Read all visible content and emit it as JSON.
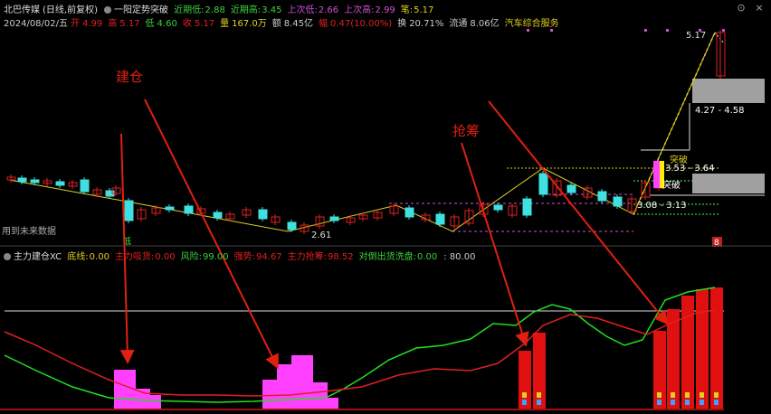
{
  "header": {
    "stock_name": "北巴传媒",
    "period": "(日线,前复权)",
    "indicator_name": "一阳定势突破",
    "items": [
      {
        "label": "近期低:",
        "value": "2.88",
        "color": "#3dd13d"
      },
      {
        "label": "近期高:",
        "value": "3.45",
        "color": "#3dd13d"
      },
      {
        "label": "上次低:",
        "value": "2.66",
        "color": "#d050d0"
      },
      {
        "label": "上次高:",
        "value": "2.99",
        "color": "#d050d0"
      },
      {
        "label": "笔:",
        "value": "5.17",
        "color": "#e0d020"
      }
    ]
  },
  "quote": {
    "date": "2024/08/02/五",
    "open_label": "开",
    "open": "4.99",
    "high_label": "高",
    "high": "5.17",
    "low_label": "低",
    "low": "4.60",
    "close_label": "收",
    "close": "5.17",
    "volume_label": "量",
    "volume": "167.0万",
    "amount_label": "额",
    "amount": "8.45亿",
    "change_label": "幅",
    "change": "0.47(10.00%)",
    "turnover_label": "换",
    "turnover": "20.71%",
    "float_label": "流通",
    "float": "8.06亿",
    "sector": "汽车综合服务"
  },
  "annotations": {
    "build": "建仓",
    "grab": "抢筹",
    "future_data": "用到未来数据",
    "low_price": "2.61",
    "high_price": "5.17",
    "breakout": "突破",
    "breakout2": "突破",
    "box_upper": "4.27 - 4.58",
    "box_mid": "3.53 - 3.64",
    "box_lower": "3.08 - 3.13",
    "dd_label": "低",
    "s_badge": "8"
  },
  "indicator": {
    "name": "主力建仓XC",
    "items": [
      {
        "label": "底线:",
        "value": "0.00",
        "color": "#e0d020"
      },
      {
        "label": "主力吸货:",
        "value": "0.00",
        "color": "#e02020"
      },
      {
        "label": "风险:",
        "value": "99.00",
        "color": "#3dd13d"
      },
      {
        "label": "强势:",
        "value": "94.67",
        "color": "#e02020"
      },
      {
        "label": "主力抢筹:",
        "value": "98.52",
        "color": "#e02020"
      },
      {
        "label": "对倒出货洗盘:",
        "value": "0.00",
        "color": "#3dd13d"
      },
      {
        "label": "",
        "value": ": 80.00",
        "color": "#cccccc"
      }
    ]
  },
  "colors": {
    "up": "#e02020",
    "down": "#40e0e0",
    "arrow": "#e02010",
    "magenta_bar": "#ff40ff"
  },
  "window": {
    "close_icon": "×",
    "menu_icon": "⊙"
  }
}
